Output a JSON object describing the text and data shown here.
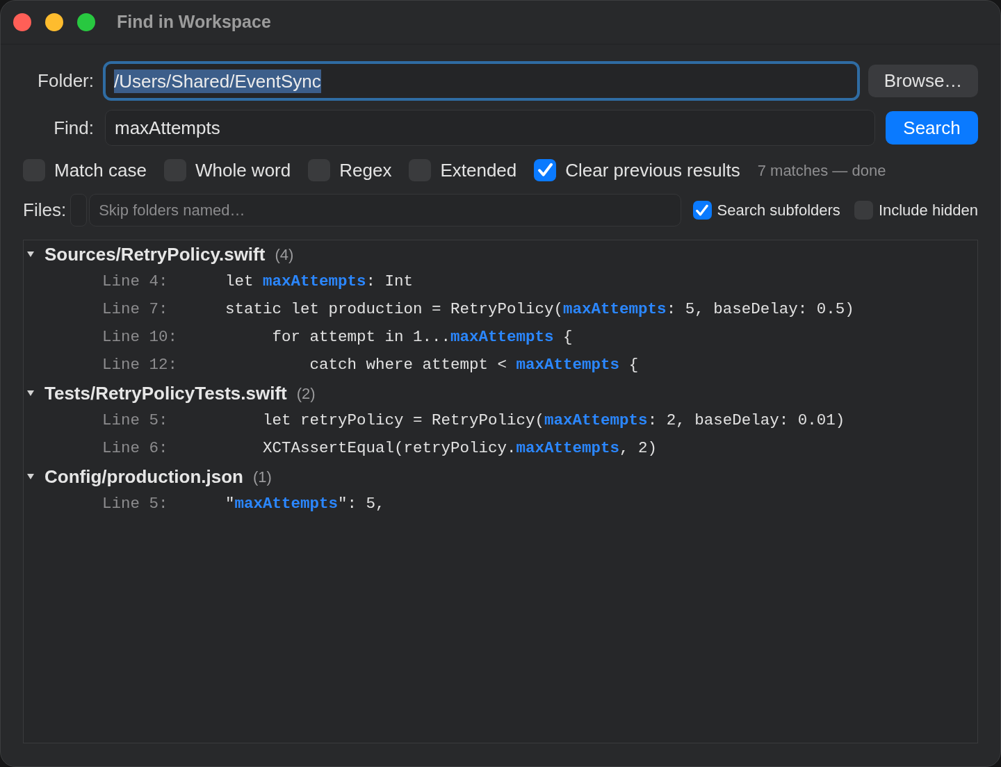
{
  "window": {
    "title": "Find in Workspace"
  },
  "folder": {
    "label": "Folder:",
    "value": "/Users/Shared/EventSync",
    "focused": true,
    "text_selected": true
  },
  "browse_button": "Browse…",
  "find": {
    "label": "Find:",
    "value": "maxAttempts"
  },
  "search_button": "Search",
  "options": [
    {
      "label": "Match case",
      "checked": false
    },
    {
      "label": "Whole word",
      "checked": false
    },
    {
      "label": "Regex",
      "checked": false
    },
    {
      "label": "Extended",
      "checked": false
    },
    {
      "label": "Clear previous results",
      "checked": true
    }
  ],
  "status": "7 matches — done",
  "files": {
    "label": "Files:",
    "placeholder": "Skip folders named…"
  },
  "file_options": [
    {
      "label": "Search subfolders",
      "checked": true
    },
    {
      "label": "Include hidden",
      "checked": false
    }
  ],
  "results": [
    {
      "file": "Sources/RetryPolicy.swift",
      "count": "(4)",
      "expanded": true,
      "children": [
        {
          "line": "Line 4:",
          "code": "let **maxAttempts**: Int"
        },
        {
          "line": "Line 7:",
          "code": "static let production = RetryPolicy(**maxAttempts**: 5, baseDelay: 0.5)"
        },
        {
          "line": "Line 10:",
          "code": "     for attempt in 1...**maxAttempts** {"
        },
        {
          "line": "Line 12:",
          "code": "         catch where attempt < **maxAttempts** {"
        }
      ]
    },
    {
      "file": "Tests/RetryPolicyTests.swift",
      "count": "(2)",
      "expanded": true,
      "children": [
        {
          "line": "Line 5:",
          "code": "    let retryPolicy = RetryPolicy(**maxAttempts**: 2, baseDelay: 0.01)"
        },
        {
          "line": "Line 6:",
          "code": "    XCTAssertEqual(retryPolicy.**maxAttempts**, 2)"
        }
      ]
    },
    {
      "file": "Config/production.json",
      "count": "(1)",
      "expanded": true,
      "children": [
        {
          "line": "Line 5:",
          "code": "\"**maxAttempts**\": 5,"
        }
      ]
    }
  ]
}
